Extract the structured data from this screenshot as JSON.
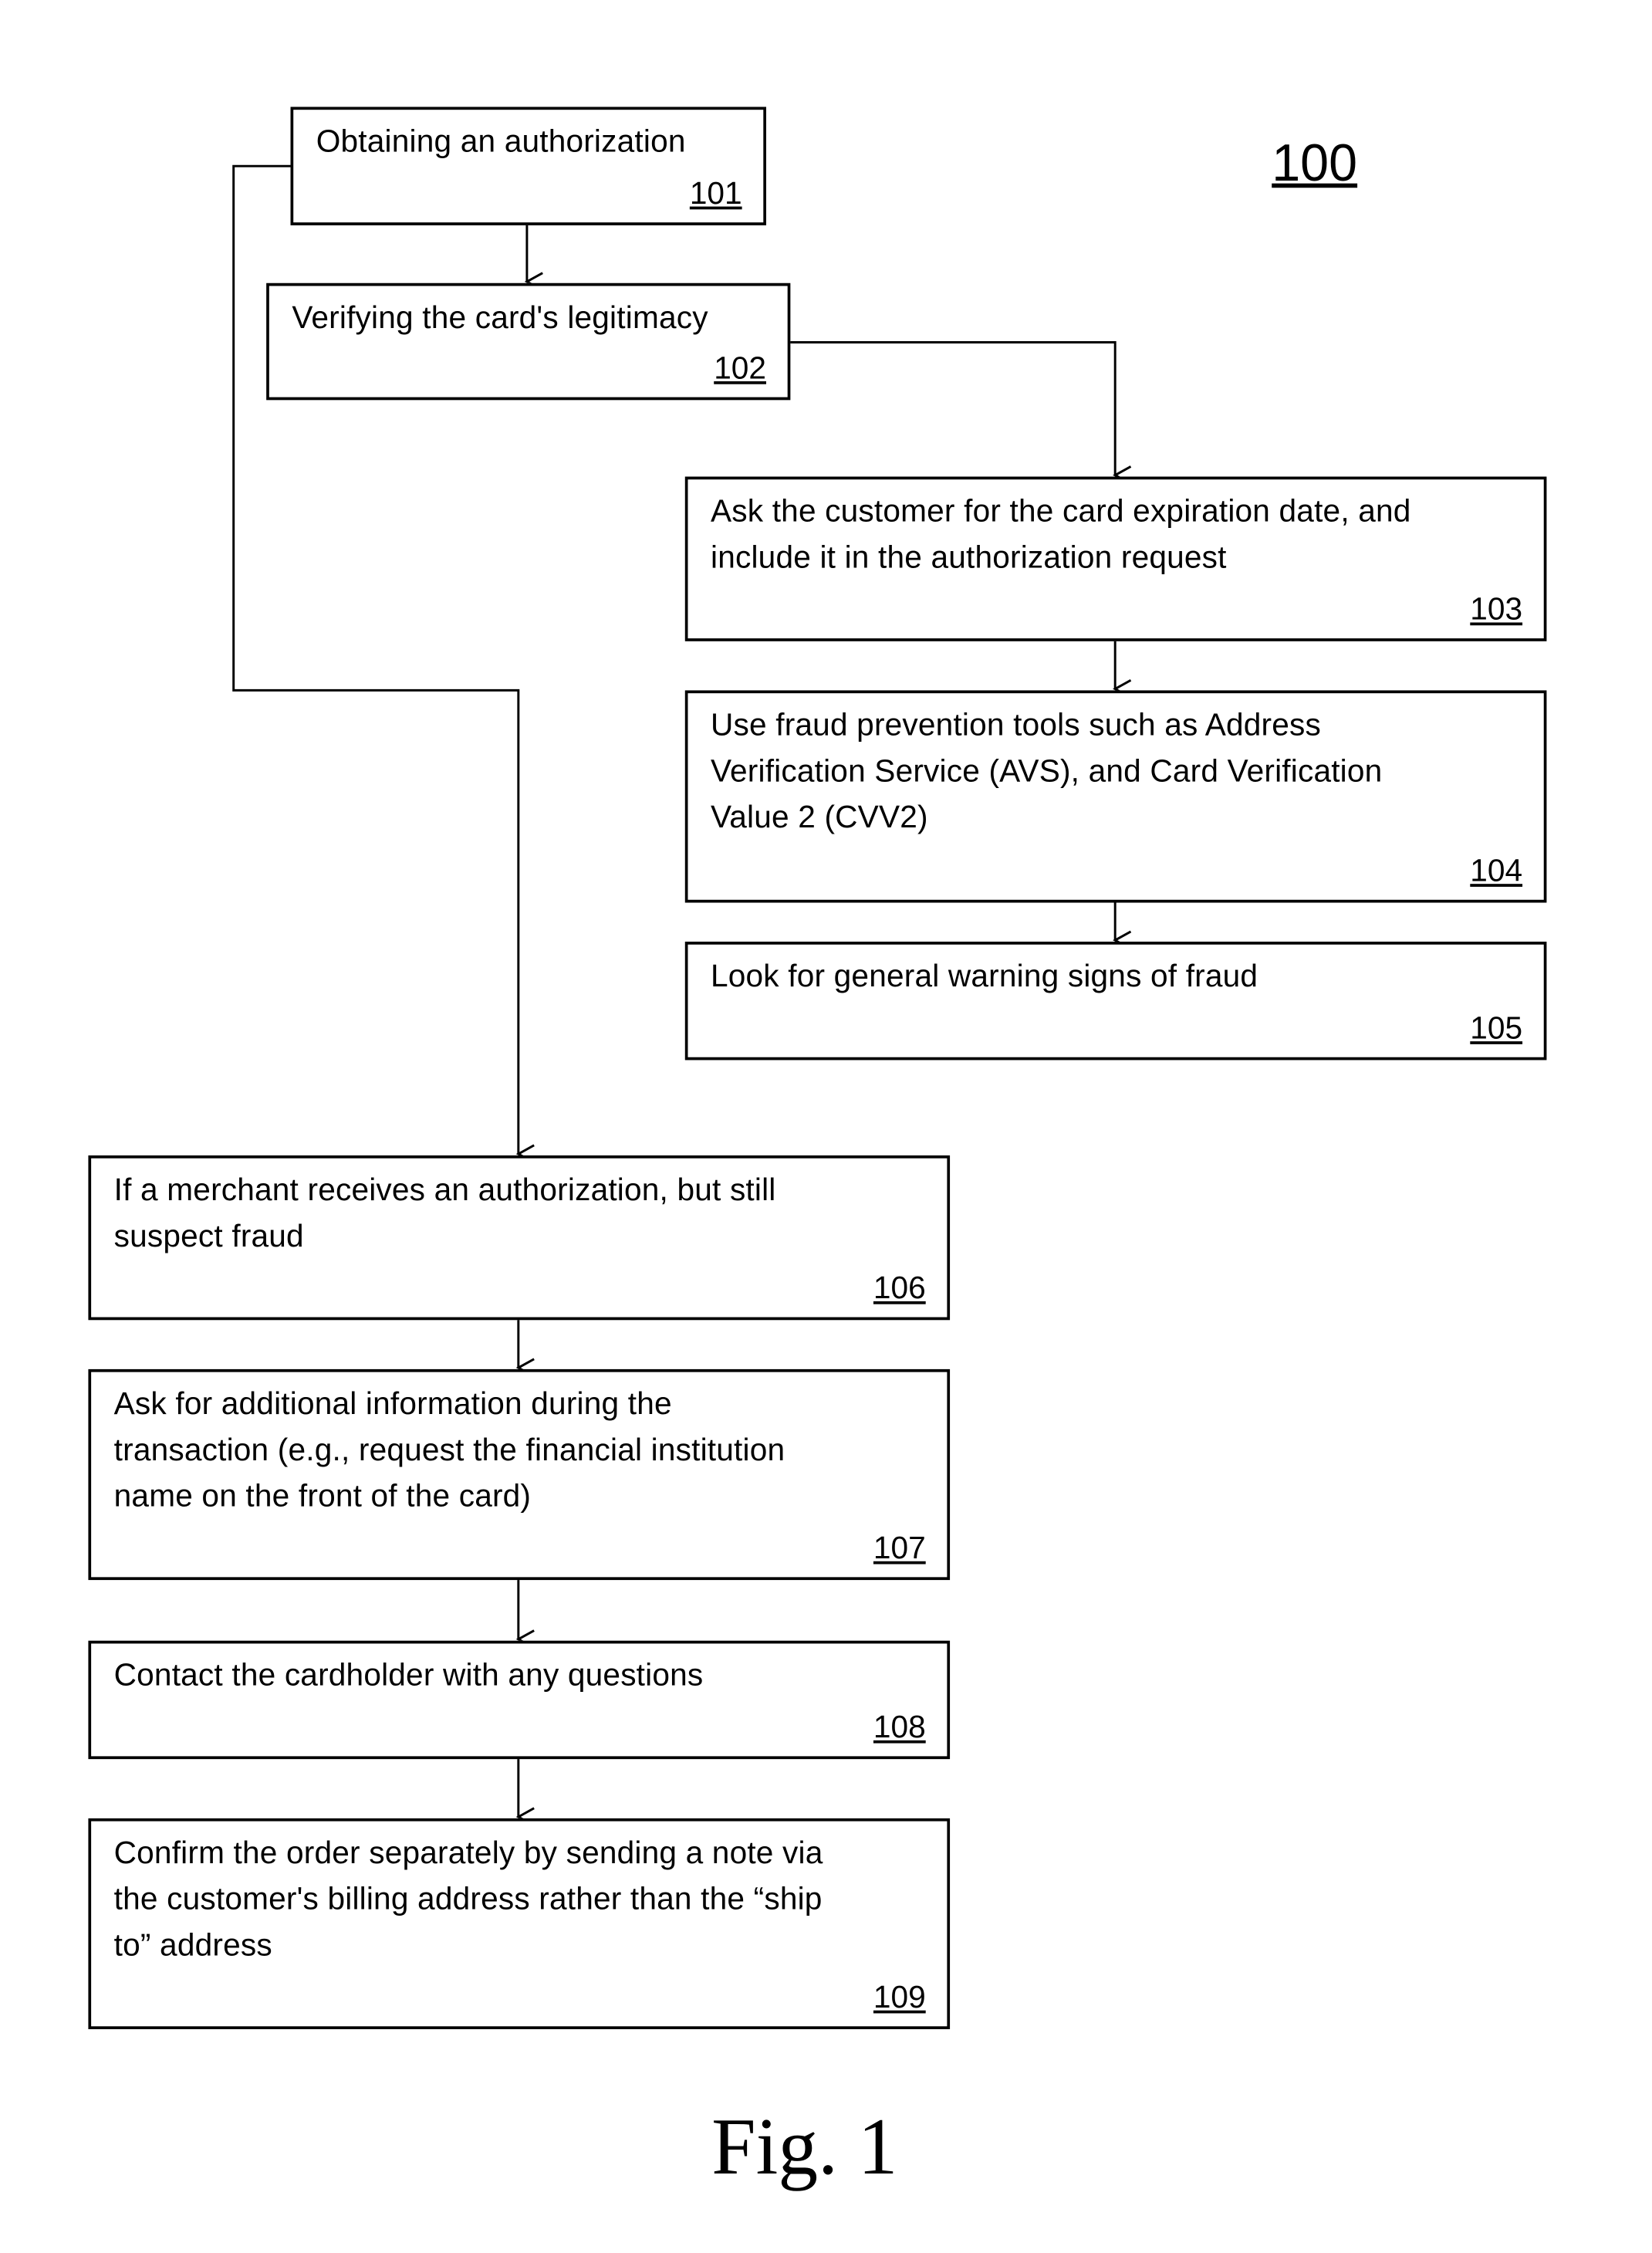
{
  "figure": {
    "reference_numeral": "100",
    "caption": "Fig. 1"
  },
  "steps": [
    {
      "id": "101",
      "text": "Obtaining an authorization"
    },
    {
      "id": "102",
      "text": "Verifying the card's legitimacy"
    },
    {
      "id": "103",
      "text": "Ask the customer for the card expiration date, and\ninclude it in the authorization request"
    },
    {
      "id": "104",
      "text": "Use fraud prevention tools such as Address\nVerification Service (AVS), and Card Verification\nValue 2 (CVV2)"
    },
    {
      "id": "105",
      "text": "Look for general warning signs of fraud"
    },
    {
      "id": "106",
      "text": "If a merchant receives an authorization, but still\nsuspect fraud"
    },
    {
      "id": "107",
      "text": "Ask for additional information during the\ntransaction (e.g., request the financial institution\nname on the front of the card)"
    },
    {
      "id": "108",
      "text": "Contact the cardholder with any questions"
    },
    {
      "id": "109",
      "text": "Confirm the order separately by sending a note via\nthe customer's billing address rather than the “ship\nto” address"
    }
  ],
  "connections": [
    {
      "from": "101",
      "to": "102"
    },
    {
      "from": "102",
      "to": "103"
    },
    {
      "from": "103",
      "to": "104"
    },
    {
      "from": "104",
      "to": "105"
    },
    {
      "from": "101",
      "to": "106"
    },
    {
      "from": "106",
      "to": "107"
    },
    {
      "from": "107",
      "to": "108"
    },
    {
      "from": "108",
      "to": "109"
    }
  ]
}
